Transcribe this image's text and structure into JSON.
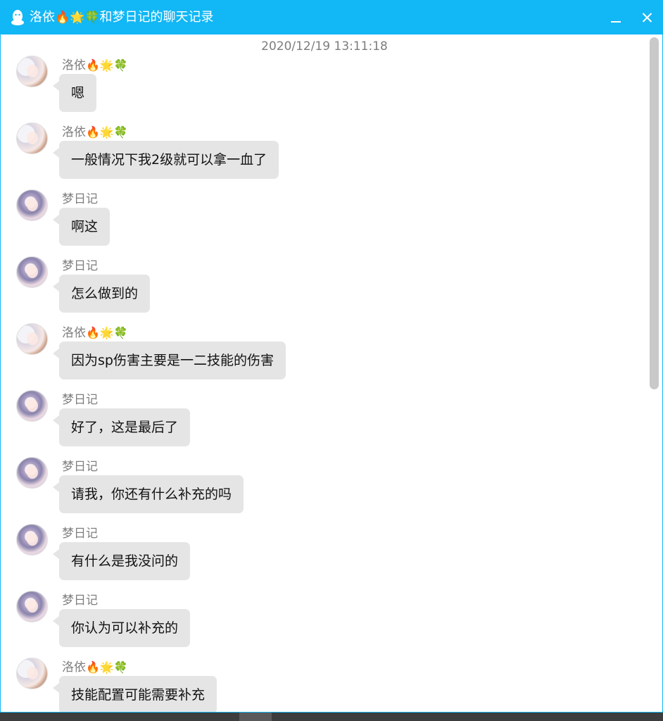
{
  "window": {
    "title_prefix": "洛依",
    "title_emojis": "🔥🌟🍀",
    "title_suffix": "和梦日记的聊天记录",
    "accent_color": "#12b7f5",
    "icons": {
      "app": "qq-penguin-icon",
      "minimize": "minimize-icon",
      "close": "close-icon"
    }
  },
  "chat": {
    "timestamp": "2020/12/19 13:11:18",
    "messages": [
      {
        "sender": "洛依",
        "sender_emojis": "🔥🌟🍀",
        "avatar": "avatar-luoyi",
        "text": "嗯"
      },
      {
        "sender": "洛依",
        "sender_emojis": "🔥🌟🍀",
        "avatar": "avatar-luoyi",
        "text": "一般情况下我2级就可以拿一血了"
      },
      {
        "sender": "梦日记",
        "sender_emojis": "",
        "avatar": "avatar-mengri",
        "text": "啊这"
      },
      {
        "sender": "梦日记",
        "sender_emojis": "",
        "avatar": "avatar-mengri",
        "text": "怎么做到的"
      },
      {
        "sender": "洛依",
        "sender_emojis": "🔥🌟🍀",
        "avatar": "avatar-luoyi",
        "text": "因为sp伤害主要是一二技能的伤害"
      },
      {
        "sender": "梦日记",
        "sender_emojis": "",
        "avatar": "avatar-mengri",
        "text": "好了，这是最后了"
      },
      {
        "sender": "梦日记",
        "sender_emojis": "",
        "avatar": "avatar-mengri",
        "text": "请我，你还有什么补充的吗"
      },
      {
        "sender": "梦日记",
        "sender_emojis": "",
        "avatar": "avatar-mengri",
        "text": "有什么是我没问的"
      },
      {
        "sender": "梦日记",
        "sender_emojis": "",
        "avatar": "avatar-mengri",
        "text": "你认为可以补充的"
      },
      {
        "sender": "洛依",
        "sender_emojis": "🔥🌟🍀",
        "avatar": "avatar-luoyi",
        "text": "技能配置可能需要补充"
      }
    ]
  }
}
